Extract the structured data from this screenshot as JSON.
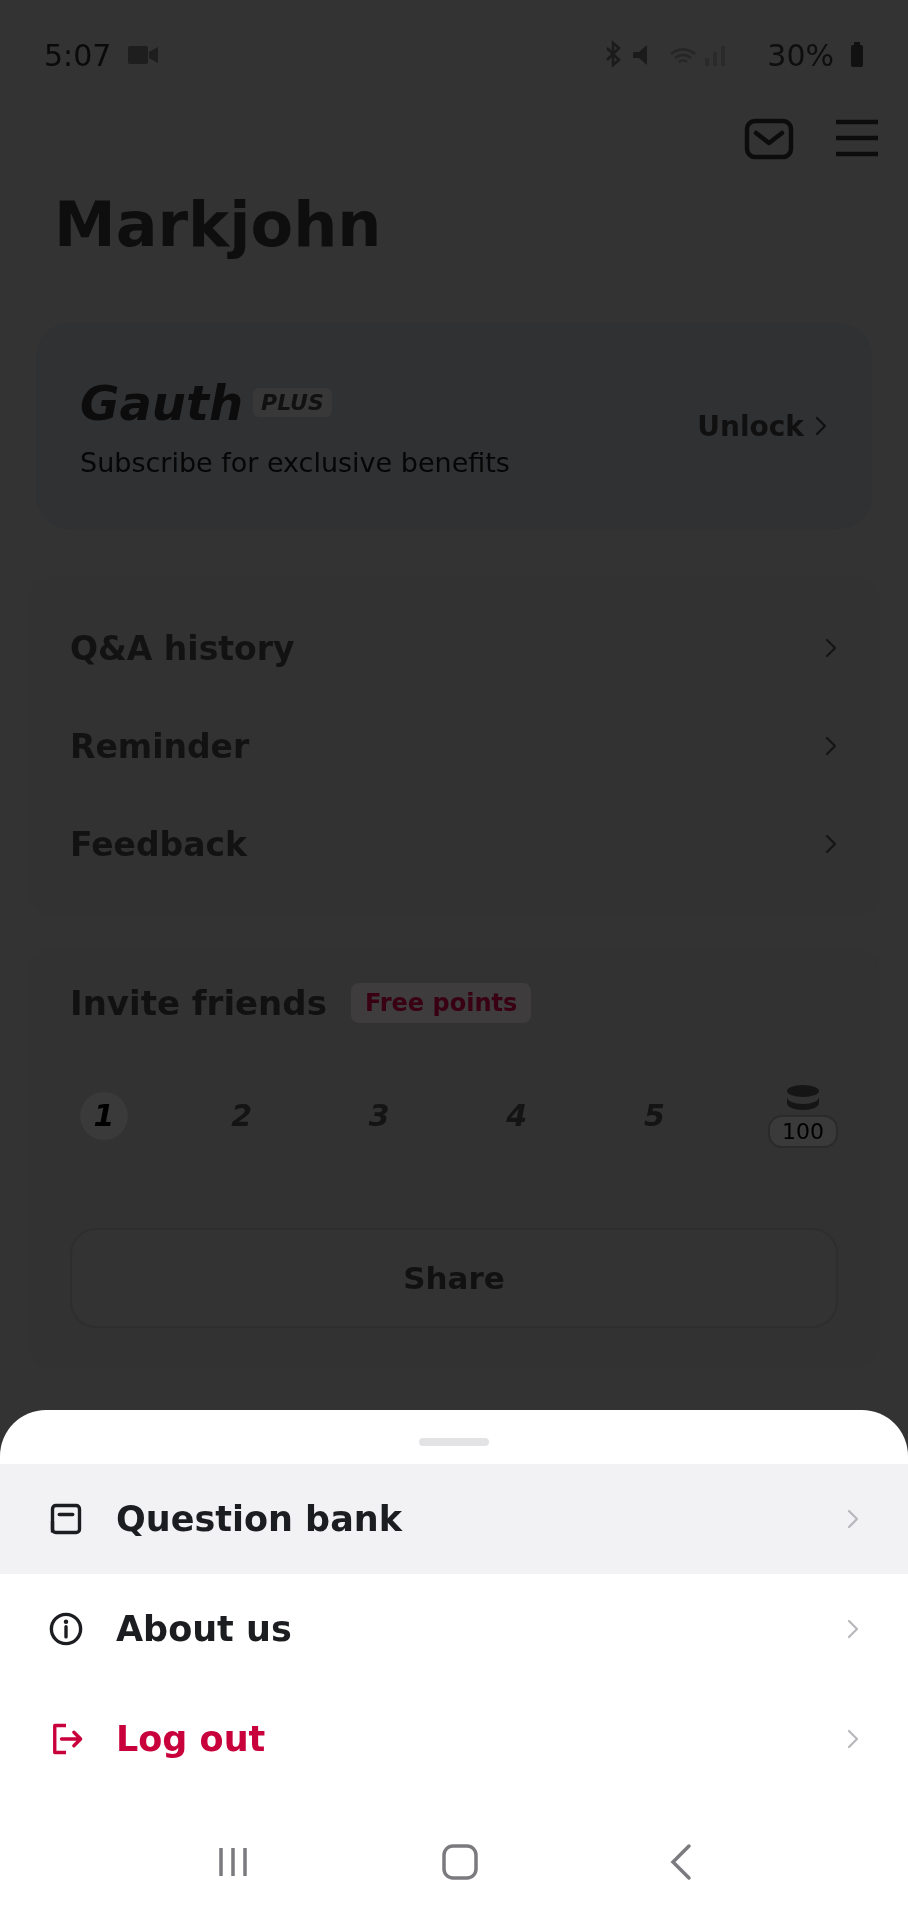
{
  "status_bar": {
    "time": "5:07",
    "battery": "30%"
  },
  "profile": {
    "name": "Markjohn"
  },
  "plus_card": {
    "brand": "Gauth",
    "badge": "PLUS",
    "subtitle": "Subscribe for exclusive benefits",
    "action": "Unlock"
  },
  "menu": [
    {
      "label": "Q&A history"
    },
    {
      "label": "Reminder"
    },
    {
      "label": "Feedback"
    }
  ],
  "invite": {
    "title": "Invite friends",
    "tag": "Free points",
    "steps": [
      {
        "label": "1",
        "done": true
      },
      {
        "label": "2",
        "done": false
      },
      {
        "label": "3",
        "done": false
      },
      {
        "label": "4",
        "done": false
      },
      {
        "label": "5",
        "done": false
      }
    ],
    "reward": "100",
    "button": "Share"
  },
  "sheet": {
    "items": [
      {
        "kind": "bank",
        "label": "Question bank",
        "selected": true
      },
      {
        "kind": "info",
        "label": "About us",
        "selected": false
      },
      {
        "kind": "logout",
        "label": "Log out",
        "selected": false
      }
    ]
  }
}
